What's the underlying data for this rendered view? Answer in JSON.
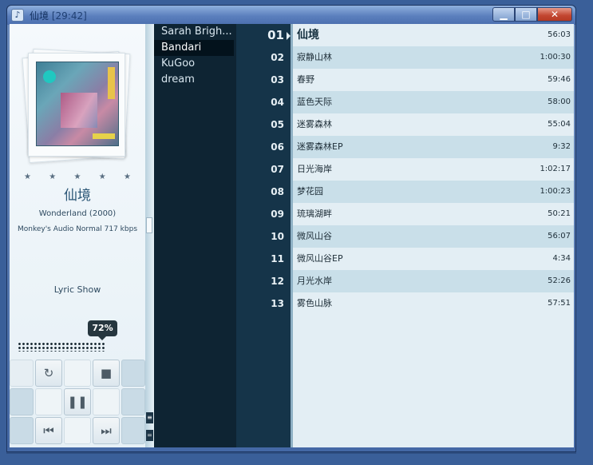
{
  "window": {
    "title": "仙境",
    "time": "[29:42]",
    "app_icon": "music-player-icon"
  },
  "album": {
    "title": "仙境",
    "subtitle": "Wonderland (2000)",
    "format": "Monkey's Audio",
    "quality": "Normal",
    "bitrate": "717 kbps",
    "rating_stars": 5
  },
  "lyric_show": "Lyric Show",
  "volume": {
    "label": "72%",
    "value": 72
  },
  "artists": [
    {
      "name": "Sarah Brigh...",
      "selected": false
    },
    {
      "name": "Bandari",
      "selected": true
    },
    {
      "name": "KuGoo",
      "selected": false
    },
    {
      "name": "dream",
      "selected": false
    }
  ],
  "tracks": [
    {
      "num": "01",
      "title": "仙境",
      "duration": "56:03",
      "current": true
    },
    {
      "num": "02",
      "title": "寂静山林",
      "duration": "1:00:30"
    },
    {
      "num": "03",
      "title": "春野",
      "duration": "59:46"
    },
    {
      "num": "04",
      "title": "蓝色天际",
      "duration": "58:00"
    },
    {
      "num": "05",
      "title": "迷雾森林",
      "duration": "55:04"
    },
    {
      "num": "06",
      "title": "迷雾森林EP",
      "duration": "9:32"
    },
    {
      "num": "07",
      "title": "日光海岸",
      "duration": "1:02:17"
    },
    {
      "num": "08",
      "title": "梦花园",
      "duration": "1:00:23"
    },
    {
      "num": "09",
      "title": "琉璃湖畔",
      "duration": "50:21"
    },
    {
      "num": "10",
      "title": "微风山谷",
      "duration": "56:07"
    },
    {
      "num": "11",
      "title": "微风山谷EP",
      "duration": "4:34"
    },
    {
      "num": "12",
      "title": "月光水岸",
      "duration": "52:26"
    },
    {
      "num": "13",
      "title": "雾色山脉",
      "duration": "57:51"
    }
  ],
  "controls": {
    "repeat_icon": "repeat-icon",
    "stop_icon": "stop-icon",
    "pause_icon": "pause-icon",
    "prev_icon": "previous-icon",
    "next_icon": "next-icon"
  }
}
